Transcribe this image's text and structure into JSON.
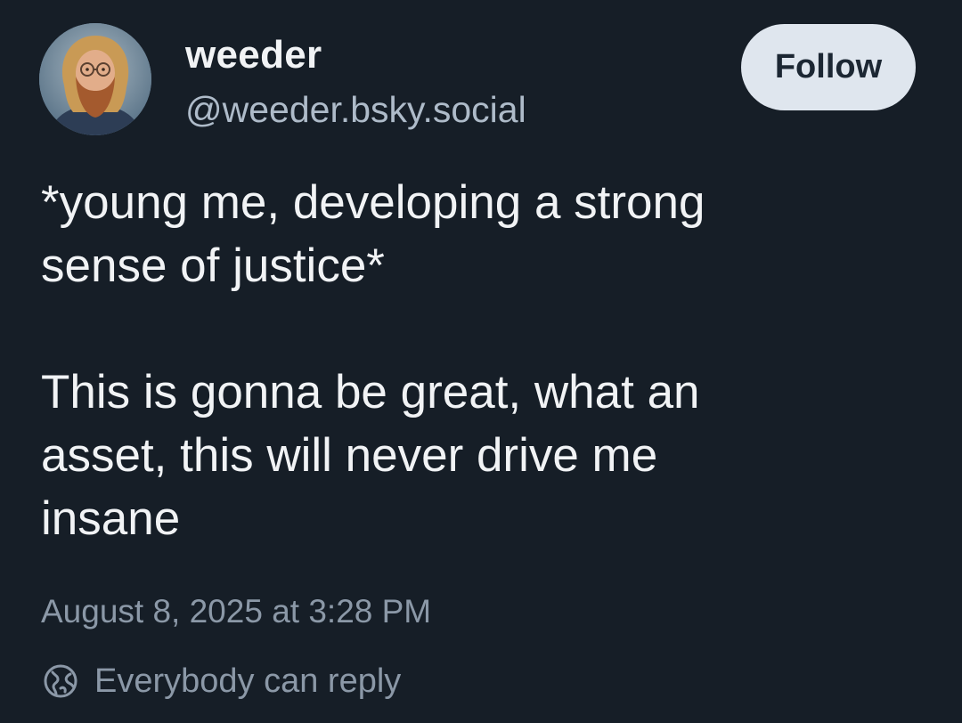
{
  "author": {
    "display_name": "weeder",
    "handle": "@weeder.bsky.social",
    "avatar": "bearded-man-avatar"
  },
  "follow_button": {
    "label": "Follow"
  },
  "post": {
    "text": "*young me, developing a strong\nsense of justice*\n\nThis is gonna be great, what an\nasset, this will never drive me\ninsane",
    "timestamp": "August 8, 2025 at 3:28 PM"
  },
  "reply_setting": {
    "icon": "globe-icon",
    "label": "Everybody can reply"
  },
  "colors": {
    "background": "#161e27",
    "text_primary": "#f1f3f5",
    "text_secondary": "#8b98a7",
    "handle": "#aebbc9",
    "follow_button_bg": "#dfe6ee",
    "follow_button_text": "#1c2733"
  }
}
